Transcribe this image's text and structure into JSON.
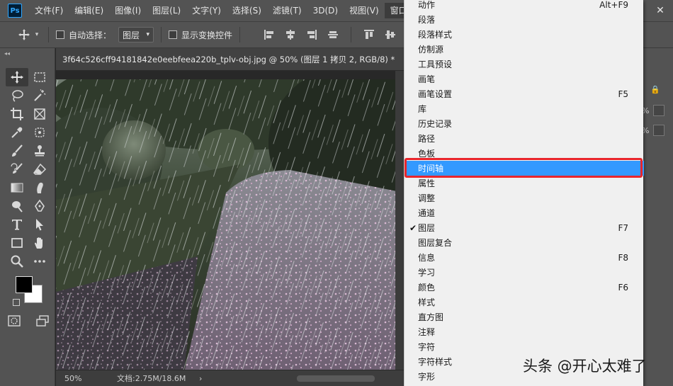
{
  "app": {
    "logo_text": "Ps"
  },
  "menubar": {
    "items": [
      "文件(F)",
      "编辑(E)",
      "图像(I)",
      "图层(L)",
      "文字(Y)",
      "选择(S)",
      "滤镜(T)",
      "3D(D)",
      "视图(V)",
      "窗口(W)"
    ],
    "active_item": "窗口(W)",
    "window_controls": {
      "minimize": "—",
      "close": "✕"
    }
  },
  "options_bar": {
    "auto_select_label": "自动选择：",
    "auto_select_checked": false,
    "auto_select_target": "图层",
    "show_transform_label": "显示变换控件",
    "show_transform_checked": false
  },
  "document": {
    "tab_title": "3f64c526cff94181842e0eebfeea220b_tplv-obj.jpg @ 50% (图层 1 拷贝 2, RGB/8) *",
    "zoom": "50%",
    "doc_info": "文档:2.75M/18.6M",
    "status_arrow": "›"
  },
  "tools": [
    "move-tool",
    "marquee-tool",
    "lasso-tool",
    "magic-wand-tool",
    "crop-tool",
    "frame-tool",
    "eyedropper-tool",
    "healing-brush-tool",
    "brush-tool",
    "clone-stamp-tool",
    "history-brush-tool",
    "eraser-tool",
    "gradient-tool",
    "smudge-tool",
    "dodge-tool",
    "pen-tool",
    "type-tool",
    "path-selection-tool",
    "rectangle-tool",
    "hand-tool",
    "zoom-tool",
    "more-tools"
  ],
  "colors": {
    "foreground": "#000000",
    "background": "#ffffff",
    "menu_highlight": "#3399ff",
    "callout_border": "#e8262d"
  },
  "right_panel": {
    "percent_1": "%",
    "percent_2": "%"
  },
  "window_menu": {
    "items": [
      {
        "label": "动作",
        "shortcut": "Alt+F9",
        "checked": false,
        "highlighted": false
      },
      {
        "label": "段落",
        "shortcut": "",
        "checked": false,
        "highlighted": false
      },
      {
        "label": "段落样式",
        "shortcut": "",
        "checked": false,
        "highlighted": false
      },
      {
        "label": "仿制源",
        "shortcut": "",
        "checked": false,
        "highlighted": false
      },
      {
        "label": "工具预设",
        "shortcut": "",
        "checked": false,
        "highlighted": false
      },
      {
        "label": "画笔",
        "shortcut": "",
        "checked": false,
        "highlighted": false
      },
      {
        "label": "画笔设置",
        "shortcut": "F5",
        "checked": false,
        "highlighted": false
      },
      {
        "label": "库",
        "shortcut": "",
        "checked": false,
        "highlighted": false
      },
      {
        "label": "历史记录",
        "shortcut": "",
        "checked": false,
        "highlighted": false
      },
      {
        "label": "路径",
        "shortcut": "",
        "checked": false,
        "highlighted": false
      },
      {
        "label": "色板",
        "shortcut": "",
        "checked": false,
        "highlighted": false
      },
      {
        "label": "时间轴",
        "shortcut": "",
        "checked": false,
        "highlighted": true
      },
      {
        "label": "属性",
        "shortcut": "",
        "checked": false,
        "highlighted": false
      },
      {
        "label": "调整",
        "shortcut": "",
        "checked": false,
        "highlighted": false
      },
      {
        "label": "通道",
        "shortcut": "",
        "checked": false,
        "highlighted": false
      },
      {
        "label": "图层",
        "shortcut": "F7",
        "checked": true,
        "highlighted": false
      },
      {
        "label": "图层复合",
        "shortcut": "",
        "checked": false,
        "highlighted": false
      },
      {
        "label": "信息",
        "shortcut": "F8",
        "checked": false,
        "highlighted": false
      },
      {
        "label": "学习",
        "shortcut": "",
        "checked": false,
        "highlighted": false
      },
      {
        "label": "颜色",
        "shortcut": "F6",
        "checked": false,
        "highlighted": false
      },
      {
        "label": "样式",
        "shortcut": "",
        "checked": false,
        "highlighted": false
      },
      {
        "label": "直方图",
        "shortcut": "",
        "checked": false,
        "highlighted": false
      },
      {
        "label": "注释",
        "shortcut": "",
        "checked": false,
        "highlighted": false
      },
      {
        "label": "字符",
        "shortcut": "",
        "checked": false,
        "highlighted": false
      },
      {
        "label": "字符样式",
        "shortcut": "",
        "checked": false,
        "highlighted": false
      },
      {
        "label": "字形",
        "shortcut": "",
        "checked": false,
        "highlighted": false
      }
    ]
  },
  "watermark": "头条 @开心太难了"
}
